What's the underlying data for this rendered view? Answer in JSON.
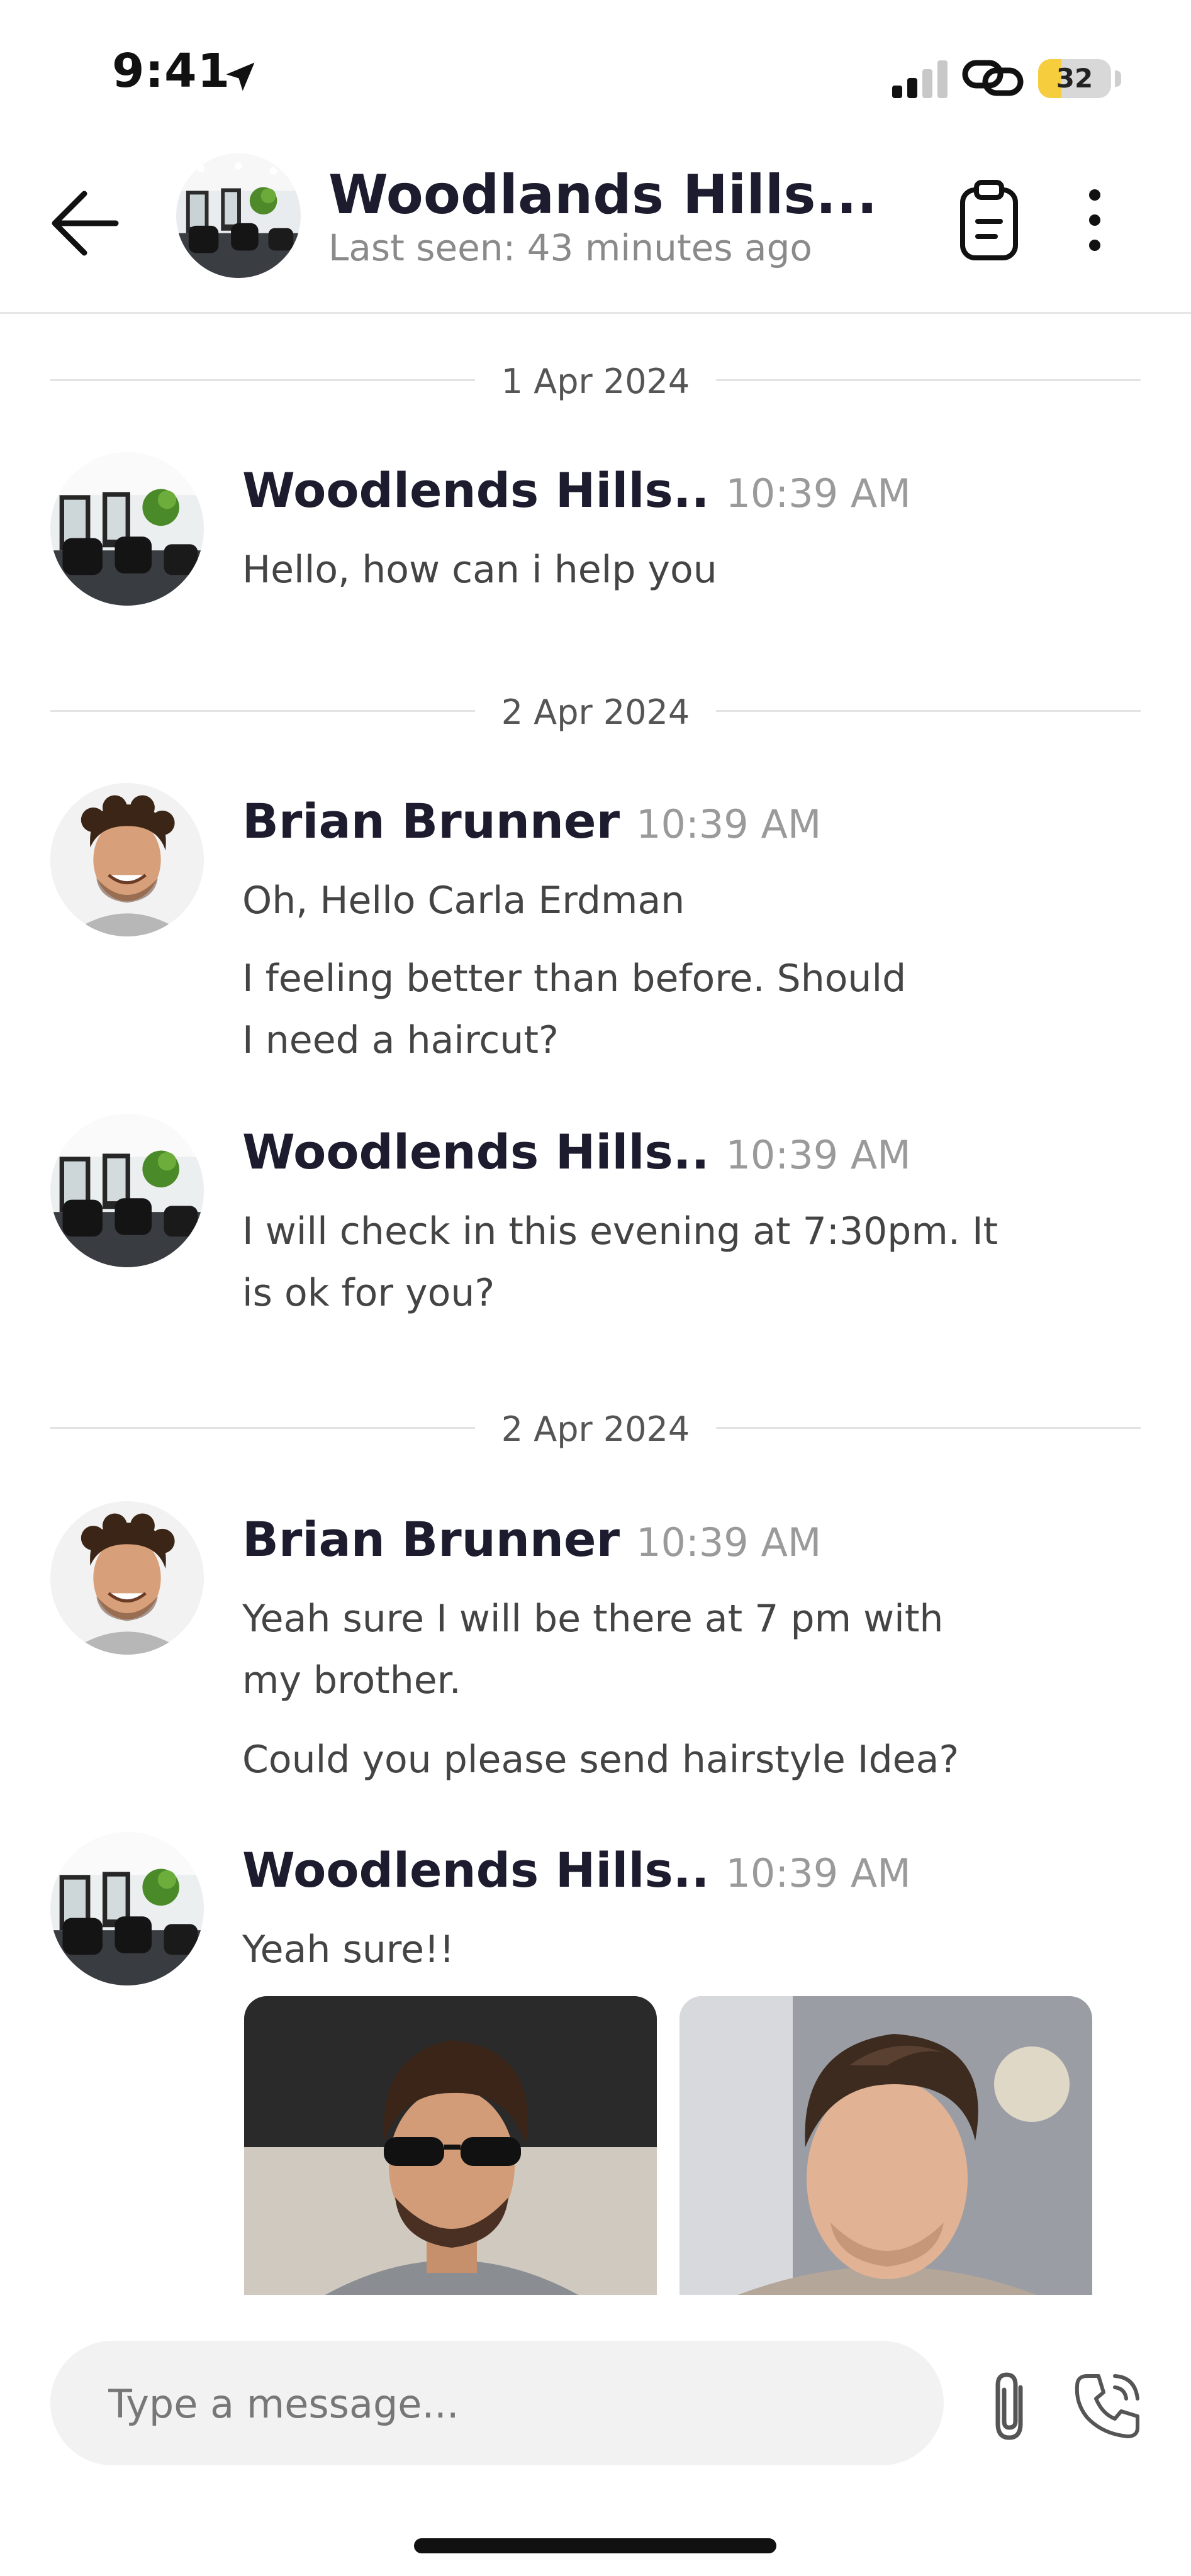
{
  "status_bar": {
    "time": "9:41",
    "battery": "32",
    "battery_level": 0.32,
    "icons": [
      "location-arrow-icon",
      "cellular-signal-icon",
      "link-icon",
      "battery-icon"
    ]
  },
  "header": {
    "title": "Woodlands Hills...",
    "subtitle": "Last seen: 43 minutes ago",
    "icons": [
      "back-arrow-icon",
      "clipboard-icon",
      "more-vertical-icon"
    ]
  },
  "messages": [
    {
      "type": "date",
      "label": "1 Apr 2024"
    },
    {
      "type": "message",
      "sender": "Woodlends Hills..",
      "time": "10:39 AM",
      "avatar": "salon-interior-avatar",
      "lines": [
        "Hello, how can i help you"
      ]
    },
    {
      "type": "date",
      "label": "2 Apr 2024"
    },
    {
      "type": "message",
      "sender": "Brian Brunner",
      "time": "10:39 AM",
      "avatar": "brian-avatar",
      "lines": [
        "Oh, Hello Carla Erdman",
        "I feeling better than before. Should I need a haircut?"
      ]
    },
    {
      "type": "message",
      "sender": "Woodlends Hills..",
      "time": "10:39 AM",
      "avatar": "salon-interior-avatar",
      "lines": [
        "I will check in this evening at 7:30pm. It is ok for you?"
      ]
    },
    {
      "type": "date",
      "label": "2 Apr 2024"
    },
    {
      "type": "message",
      "sender": "Brian Brunner",
      "time": "10:39 AM",
      "avatar": "brian-avatar",
      "lines": [
        "Yeah sure I will be there at 7 pm with my brother.",
        "Could you please send hairstyle Idea?"
      ]
    },
    {
      "type": "message",
      "sender": "Woodlends Hills..",
      "time": "10:39 AM",
      "avatar": "salon-interior-avatar",
      "lines": [
        "Yeah sure!!"
      ],
      "images": [
        "hairstyle-photo-1",
        "hairstyle-photo-2"
      ]
    }
  ],
  "composer": {
    "placeholder": "Type a message...",
    "icons": [
      "paperclip-icon",
      "phone-call-icon"
    ]
  },
  "colors": {
    "title": "#1d1b2e",
    "muted": "#8a8a8a",
    "battery_fill": "#f5cd3d",
    "composer_bg": "#f2f2f2"
  }
}
